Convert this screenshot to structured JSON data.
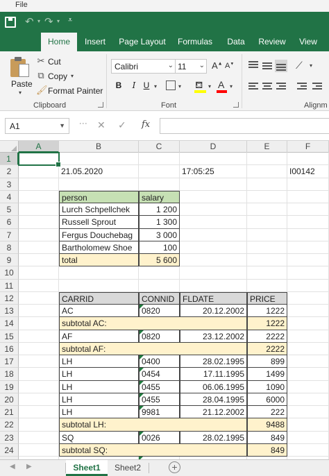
{
  "menu": {
    "file": "File"
  },
  "qat": {
    "customize_glyph": "⩡"
  },
  "tabs": [
    "Home",
    "Insert",
    "Page Layout",
    "Formulas",
    "Data",
    "Review",
    "View"
  ],
  "clipboard": {
    "paste": "Paste",
    "cut": "Cut",
    "copy": "Copy",
    "format_painter": "Format Painter",
    "group_label": "Clipboard"
  },
  "font": {
    "name": "Calibri",
    "size": "11",
    "group_label": "Font",
    "bold": "B",
    "italic": "I",
    "underline": "U",
    "grow": "A",
    "shrink": "A",
    "fill_icon": "fill-color-icon",
    "font_color_icon": "font-color-icon",
    "highlight_color": "#ffff00",
    "font_color": "#ff0000"
  },
  "alignment": {
    "group_label": "Alignm"
  },
  "formula_bar": {
    "name_box": "A1",
    "fx": "fx",
    "value": ""
  },
  "columns": [
    "A",
    "B",
    "C",
    "D",
    "E",
    "F"
  ],
  "rows": [
    "1",
    "2",
    "3",
    "4",
    "5",
    "6",
    "7",
    "8",
    "9",
    "10",
    "11",
    "12",
    "13",
    "14",
    "15",
    "16",
    "17",
    "18",
    "19",
    "20",
    "21",
    "22",
    "23",
    "24",
    "25"
  ],
  "cells": {
    "B2": "21.05.2020",
    "D2": "17:05:25",
    "F2": "I00142",
    "salary_table": {
      "headers": [
        "person",
        "salary"
      ],
      "rows": [
        [
          "Lurch Schpellchek",
          "1 200"
        ],
        [
          "Russell Sprout",
          "1 300"
        ],
        [
          "Fergus Douchebag",
          "3 000"
        ],
        [
          "Bartholomew Shoe",
          "100"
        ]
      ],
      "total_label": "total",
      "total_value": "5 600"
    },
    "flight_table": {
      "headers": [
        "CARRID",
        "CONNID",
        "FLDATE",
        "PRICE"
      ],
      "rows": [
        {
          "type": "data",
          "values": [
            "AC",
            "0820",
            "20.12.2002",
            "1222"
          ]
        },
        {
          "type": "subtotal",
          "label": "subtotal AC:",
          "value": "1222"
        },
        {
          "type": "data",
          "values": [
            "AF",
            "0820",
            "23.12.2002",
            "2222"
          ]
        },
        {
          "type": "subtotal",
          "label": "subtotal AF:",
          "value": "2222"
        },
        {
          "type": "data",
          "values": [
            "LH",
            "0400",
            "28.02.1995",
            "899"
          ]
        },
        {
          "type": "data",
          "values": [
            "LH",
            "0454",
            "17.11.1995",
            "1499"
          ]
        },
        {
          "type": "data",
          "values": [
            "LH",
            "0455",
            "06.06.1995",
            "1090"
          ]
        },
        {
          "type": "data",
          "values": [
            "LH",
            "0455",
            "28.04.1995",
            "6000"
          ]
        },
        {
          "type": "data",
          "values": [
            "LH",
            "9981",
            "21.12.2002",
            "222"
          ]
        },
        {
          "type": "subtotal",
          "label": "subtotal LH:",
          "value": "9488"
        },
        {
          "type": "data",
          "values": [
            "SQ",
            "0026",
            "28.02.1995",
            "849"
          ]
        },
        {
          "type": "subtotal",
          "label": "subtotal SQ:",
          "value": "849"
        }
      ]
    }
  },
  "sheets": [
    "Sheet1",
    "Sheet2"
  ],
  "colors": {
    "accent": "#217346",
    "header_green": "#c6e0b4",
    "subtotal_cream": "#fff2cc",
    "header_grey": "#d9d9d9"
  }
}
